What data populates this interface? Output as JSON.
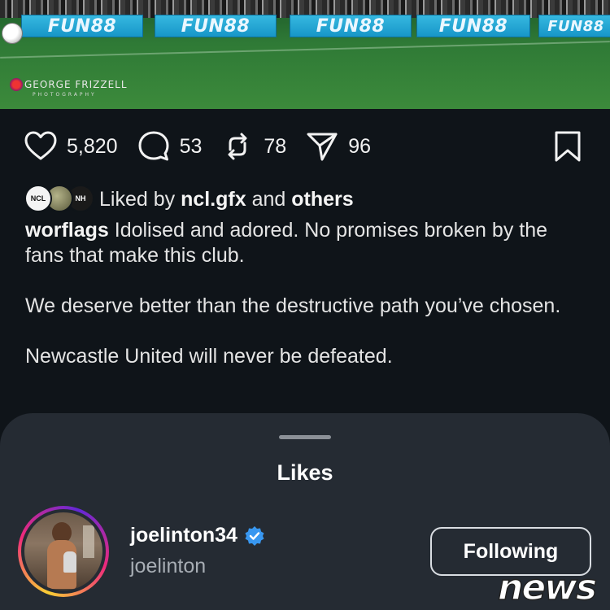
{
  "photo": {
    "ad_boards": [
      "FUN88",
      "FUN88",
      "FUN88",
      "FUN88",
      "FUN88"
    ],
    "watermark_name": "GEORGE FRIZZELL",
    "watermark_sub": "PHOTOGRAPHY"
  },
  "actions": {
    "likes": "5,820",
    "comments": "53",
    "reposts": "78",
    "shares": "96",
    "icons": [
      "heart-icon",
      "comment-icon",
      "repost-icon",
      "send-icon",
      "bookmark-icon"
    ]
  },
  "liked_by": {
    "prefix": "Liked by",
    "user": "ncl.gfx",
    "joiner": "and",
    "others": "others",
    "avatar_labels": [
      "NCL",
      "",
      "NH"
    ]
  },
  "caption": {
    "username": "worflags",
    "paragraphs": [
      "Idolised and adored. No promises broken by the fans that make this club.",
      "We deserve better than the destructive path you’ve chosen.",
      "Newcastle United will never be defeated."
    ]
  },
  "sheet": {
    "title": "Likes",
    "users": [
      {
        "username": "joelinton34",
        "fullname": "joelinton",
        "verified": true,
        "button": "Following"
      }
    ]
  },
  "overlay_logo": "news",
  "colors": {
    "background": "#0f1419",
    "sheet": "#252b33",
    "verified": "#3897f0",
    "ad_board": "#1796c8"
  }
}
